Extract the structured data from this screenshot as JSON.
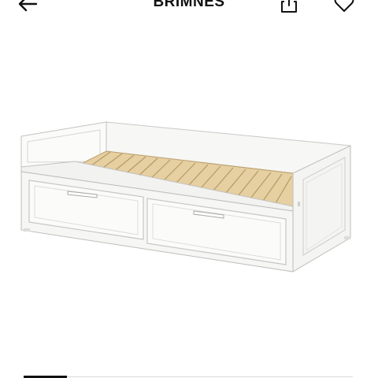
{
  "header": {
    "title": "BRIMNES",
    "back_icon": "arrow-left-icon",
    "share_icon": "share-icon",
    "favorite_icon": "heart-outline-icon"
  },
  "product": {
    "image_icon": "daybed-with-drawers-illustration",
    "colors": {
      "frame": "#f4f4f2",
      "slats": "#e6cfa0"
    }
  },
  "carousel": {
    "active_index": 1
  }
}
